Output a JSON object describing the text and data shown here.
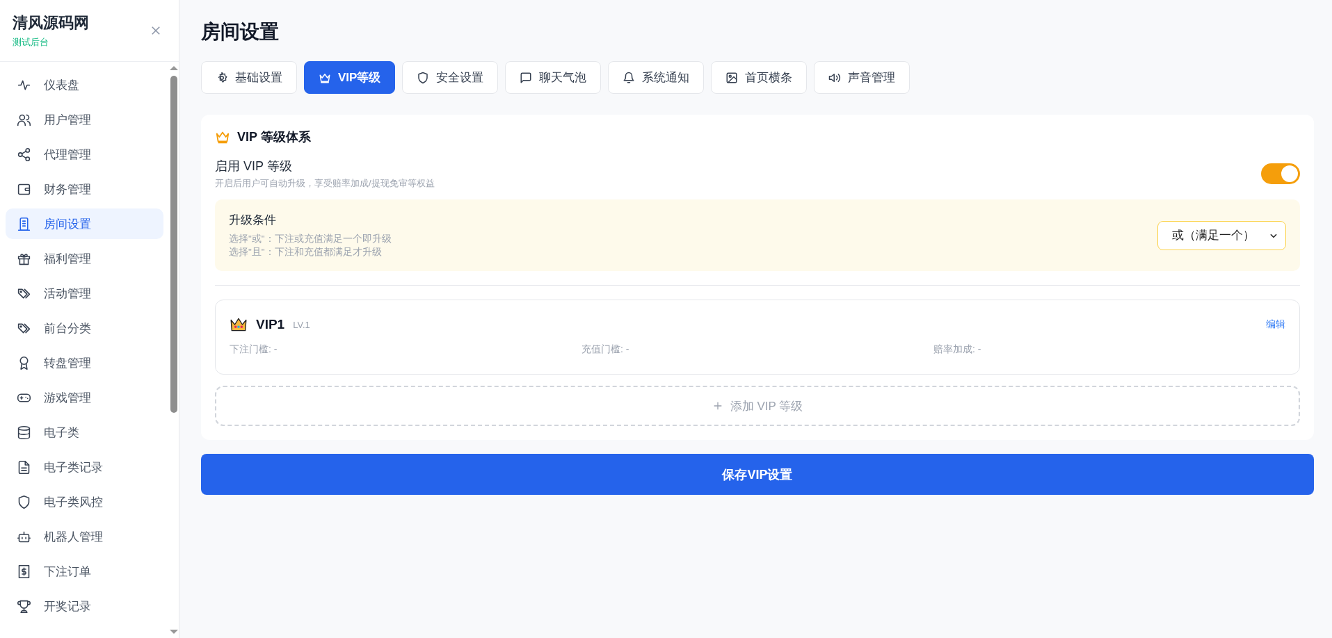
{
  "sidebar": {
    "title": "清风源码网",
    "subtitle": "测试后台",
    "items": [
      {
        "label": "仪表盘",
        "selected": false
      },
      {
        "label": "用户管理",
        "selected": false
      },
      {
        "label": "代理管理",
        "selected": false
      },
      {
        "label": "财务管理",
        "selected": false
      },
      {
        "label": "房间设置",
        "selected": true
      },
      {
        "label": "福利管理",
        "selected": false
      },
      {
        "label": "活动管理",
        "selected": false
      },
      {
        "label": "前台分类",
        "selected": false
      },
      {
        "label": "转盘管理",
        "selected": false
      },
      {
        "label": "游戏管理",
        "selected": false
      },
      {
        "label": "电子类",
        "selected": false
      },
      {
        "label": "电子类记录",
        "selected": false
      },
      {
        "label": "电子类风控",
        "selected": false
      },
      {
        "label": "机器人管理",
        "selected": false
      },
      {
        "label": "下注订单",
        "selected": false
      },
      {
        "label": "开奖记录",
        "selected": false
      }
    ]
  },
  "page_title": "房间设置",
  "tabs": [
    {
      "label": "基础设置",
      "selected": false
    },
    {
      "label": "VIP等级",
      "selected": true
    },
    {
      "label": "安全设置",
      "selected": false
    },
    {
      "label": "聊天气泡",
      "selected": false
    },
    {
      "label": "系统通知",
      "selected": false
    },
    {
      "label": "首页横条",
      "selected": false
    },
    {
      "label": "声音管理",
      "selected": false
    }
  ],
  "vip_section": {
    "title": "VIP 等级体系",
    "enable": {
      "label": "启用 VIP 等级",
      "description": "开启后用户可自动升级，享受赔率加成/提现免审等权益",
      "on": true
    },
    "upgrade_condition": {
      "label": "升级条件",
      "hints": [
        "选择\"或\"：下注或充值满足一个即升级",
        "选择\"且\"：下注和充值都满足才升级"
      ],
      "value": "或（满足一个）"
    },
    "levels": [
      {
        "name": "VIP1",
        "level_tag": "LV.1",
        "edit": "编辑",
        "fields": [
          "下注门槛: -",
          "充值门槛: -",
          "赔率加成: -"
        ]
      }
    ],
    "add_button": "添加 VIP 等级"
  },
  "save_button": "保存VIP设置"
}
